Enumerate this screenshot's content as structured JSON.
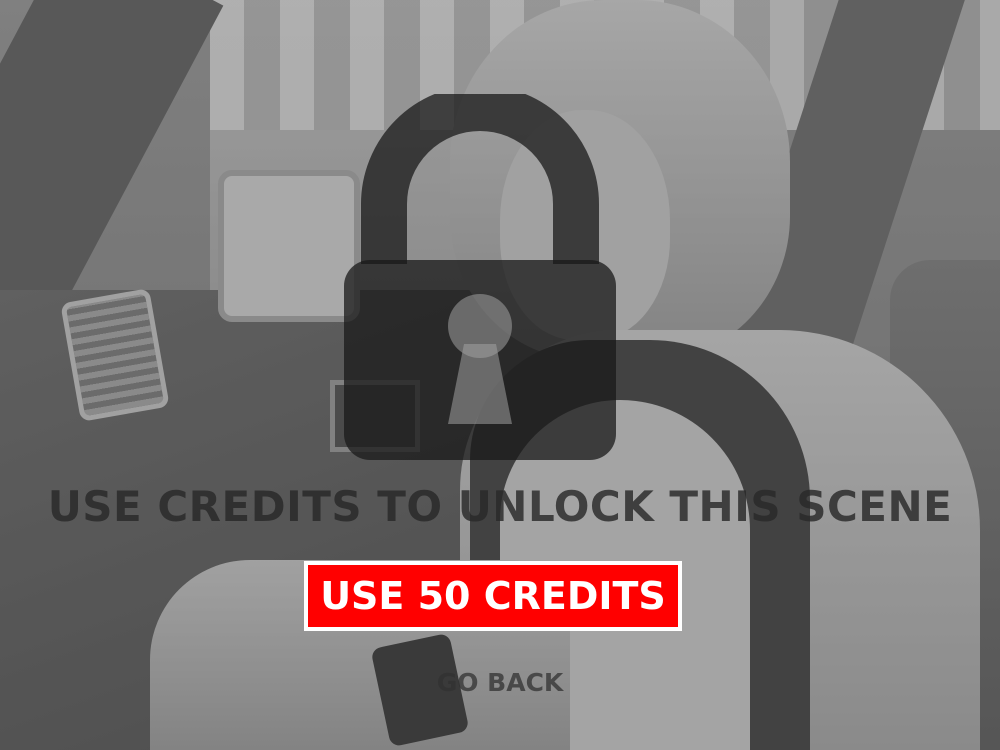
{
  "lock_screen": {
    "icon": "lock-icon",
    "prompt": "USE CREDITS TO UNLOCK THIS SCENE",
    "unlock_button_label": "USE 50 CREDITS",
    "back_label": "GO BACK"
  },
  "colors": {
    "unlock_button_bg": "#ff0000",
    "unlock_button_border": "#ffffff",
    "unlock_button_text": "#ffffff",
    "prompt_text": "#282828"
  }
}
